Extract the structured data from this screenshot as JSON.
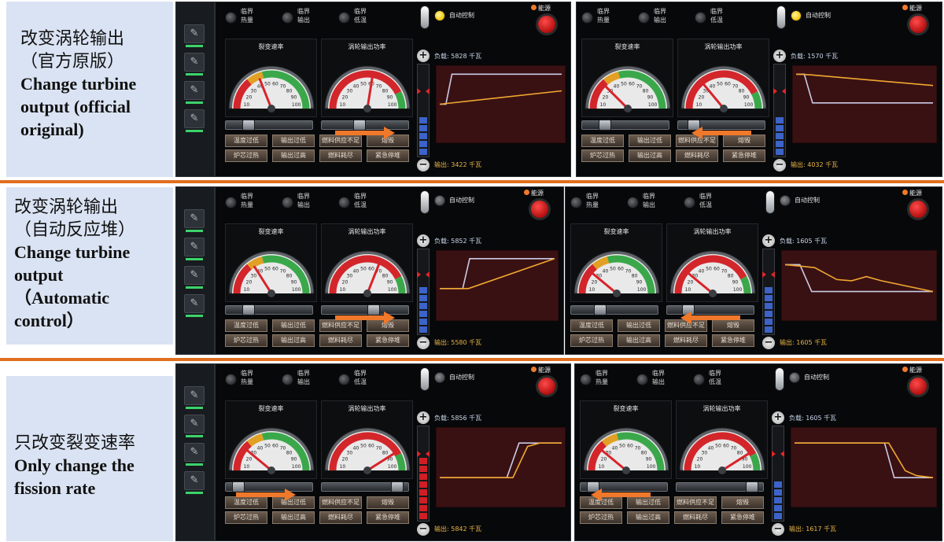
{
  "rows": [
    {
      "label_cn": [
        "改变涡轮输出",
        "（官方原版）"
      ],
      "label_en": [
        "Change turbine",
        "output (official",
        "original)"
      ],
      "panels": [
        {
          "load": "负载: 5828 千瓦",
          "output": "输出: 3422 千瓦",
          "auto_on": true,
          "arrow": "right",
          "fission_knob": 0.22,
          "turbine_knob": 0.42,
          "fission_needle": 0.38,
          "turbine_needle": 0.55,
          "bar_level": 0.45,
          "bar_color": "#3d63c8",
          "curve_white": [
            [
              0,
              0.5
            ],
            [
              0.05,
              0.5
            ],
            [
              0.1,
              0.05
            ],
            [
              1,
              0.05
            ]
          ],
          "curve_orange": [
            [
              0,
              0.5
            ],
            [
              1,
              0.3
            ]
          ]
        },
        {
          "load": "负载: 1570 千瓦",
          "output": "输出: 4032 千瓦",
          "auto_on": true,
          "arrow": "left",
          "fission_knob": 0.22,
          "turbine_knob": 0.12,
          "fission_needle": 0.25,
          "turbine_needle": 0.28,
          "bar_level": 0.45,
          "bar_color": "#3d63c8",
          "curve_white": [
            [
              0,
              0.05
            ],
            [
              0.06,
              0.05
            ],
            [
              0.12,
              0.48
            ],
            [
              1,
              0.48
            ]
          ],
          "curve_orange": [
            [
              0,
              0.05
            ],
            [
              0.1,
              0.06
            ],
            [
              1,
              0.22
            ]
          ]
        }
      ]
    },
    {
      "label_cn": [
        "改变涡轮输出",
        "（自动反应堆）"
      ],
      "label_en": [
        "Change turbine",
        "output",
        "（Automatic",
        "control）"
      ],
      "panels": [
        {
          "load": "负载: 5852 千瓦",
          "output": "输出: 5580 千瓦",
          "auto_on": false,
          "arrow": "right",
          "fission_knob": 0.22,
          "turbine_knob": 0.6,
          "fission_needle": 0.32,
          "turbine_needle": 0.62,
          "bar_level": 0.55,
          "bar_color": "#3d63c8",
          "curve_white": [
            [
              0,
              0.55
            ],
            [
              0.2,
              0.55
            ],
            [
              0.26,
              0.05
            ],
            [
              1,
              0.05
            ]
          ],
          "curve_orange": [
            [
              0,
              0.55
            ],
            [
              0.25,
              0.55
            ],
            [
              1,
              0.05
            ]
          ]
        },
        {
          "load": "负载: 1605 千瓦",
          "output": "输出: 1605 千瓦",
          "auto_on": false,
          "arrow": "left",
          "fission_knob": 0.3,
          "turbine_knob": 0.2,
          "fission_needle": 0.22,
          "turbine_needle": 0.22,
          "bar_level": 0.55,
          "bar_color": "#3d63c8",
          "curve_white": [
            [
              0,
              0.15
            ],
            [
              0.1,
              0.15
            ],
            [
              0.18,
              0.6
            ],
            [
              1,
              0.6
            ]
          ],
          "curve_orange": [
            [
              0,
              0.15
            ],
            [
              0.2,
              0.2
            ],
            [
              0.35,
              0.4
            ],
            [
              0.45,
              0.42
            ],
            [
              0.55,
              0.35
            ],
            [
              0.65,
              0.42
            ],
            [
              1,
              0.6
            ]
          ]
        }
      ]
    },
    {
      "label_cn": [
        "只改变裂变速率"
      ],
      "label_en": [
        "Only change the",
        "fission rate"
      ],
      "panels": [
        {
          "load": "负载: 5856 千瓦",
          "output": "输出: 5842 千瓦",
          "auto_on": false,
          "arrow": "right",
          "fission_knob": 0.08,
          "turbine_knob": 0.92,
          "fission_needle": 0.22,
          "turbine_needle": 0.82,
          "bar_level": 0.75,
          "bar_color": "#d01e24",
          "curve_white": [
            [
              0,
              0.65
            ],
            [
              0.55,
              0.65
            ],
            [
              0.65,
              0.15
            ],
            [
              1,
              0.15
            ]
          ],
          "curve_orange": [
            [
              0,
              0.65
            ],
            [
              0.6,
              0.65
            ],
            [
              0.72,
              0.2
            ],
            [
              0.82,
              0.15
            ],
            [
              1,
              0.15
            ]
          ]
        },
        {
          "load": "负载: 1605 千瓦",
          "output": "输出: 1617 千瓦",
          "auto_on": false,
          "arrow": "left",
          "fission_knob": 0.08,
          "turbine_knob": 0.92,
          "fission_needle": 0.22,
          "turbine_needle": 0.82,
          "bar_level": 0.45,
          "bar_color": "#3d63c8",
          "curve_white": [
            [
              0,
              0.15
            ],
            [
              0.65,
              0.15
            ],
            [
              0.72,
              0.65
            ],
            [
              1,
              0.65
            ]
          ],
          "curve_orange": [
            [
              0,
              0.15
            ],
            [
              0.68,
              0.15
            ],
            [
              0.8,
              0.55
            ],
            [
              0.88,
              0.62
            ],
            [
              1,
              0.65
            ]
          ]
        }
      ]
    }
  ],
  "ui": {
    "warn_labels": [
      [
        "临界",
        "热量"
      ],
      [
        "临界",
        "输出"
      ],
      [
        "临界",
        "低温"
      ]
    ],
    "gauge_fission_title": "裂变速率",
    "gauge_turbine_title": "涡轮输出功率",
    "auto_label": "自动控制",
    "power_label": "能源",
    "plus": "+",
    "minus": "−",
    "buttons": [
      [
        "温度过低",
        "输出过低",
        "燃料供应不足",
        "熔毁"
      ],
      [
        "炉芯过热",
        "输出过高",
        "燃料耗尽",
        "紧急停堆"
      ]
    ],
    "gauge_ticks": [
      "10",
      "20",
      "30",
      "40",
      "50",
      "60",
      "70",
      "80",
      "90",
      "100"
    ]
  },
  "colors": {
    "auto_on": "#f5c400",
    "auto_off": "#4a4c50",
    "curve_white": "#c9cbe6",
    "curve_orange": "#f0a830",
    "arrow": "#f0782b"
  }
}
